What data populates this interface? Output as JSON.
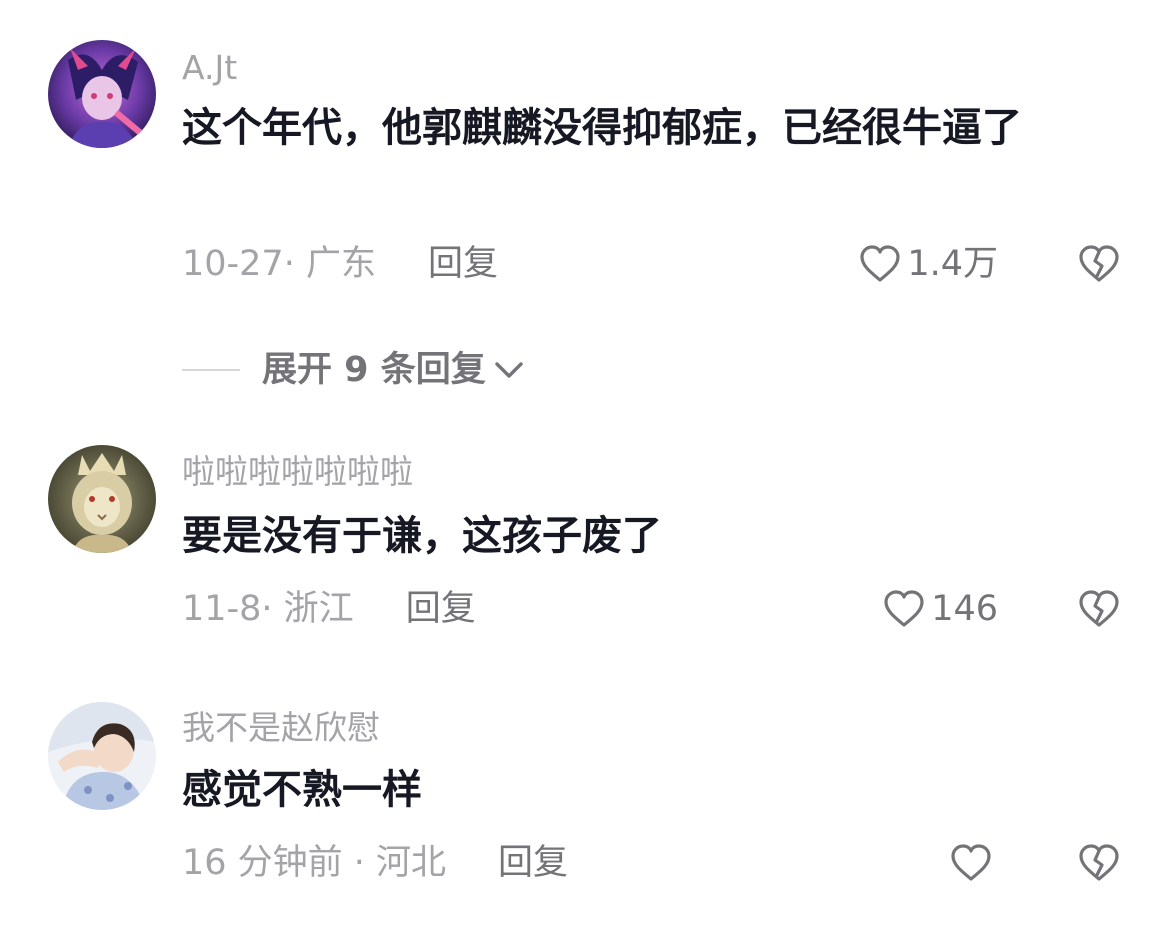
{
  "comments": [
    {
      "username": "A.Jt",
      "content": "这个年代，他郭麒麟没得抑郁症，已经很牛逼了",
      "meta": "10-27· 广东",
      "reply_label": "回复",
      "likes": "1.4万",
      "avatar_icon": "anime-character-avatar"
    },
    {
      "username": "啦啦啦啦啦啦啦",
      "content": "要是没有于谦，这孩子废了",
      "meta": "11-8· 浙江",
      "reply_label": "回复",
      "likes": "146",
      "avatar_icon": "golden-lion-avatar"
    },
    {
      "username": "我不是赵欣慰",
      "content": "感觉不熟一样",
      "meta": "16 分钟前 · 河北",
      "reply_label": "回复",
      "likes": "",
      "avatar_icon": "person-photo-avatar"
    }
  ],
  "expand_replies": "展开 9 条回复",
  "colors": {
    "text": "#161823",
    "muted": "#a3a3a8",
    "action": "#737378"
  }
}
